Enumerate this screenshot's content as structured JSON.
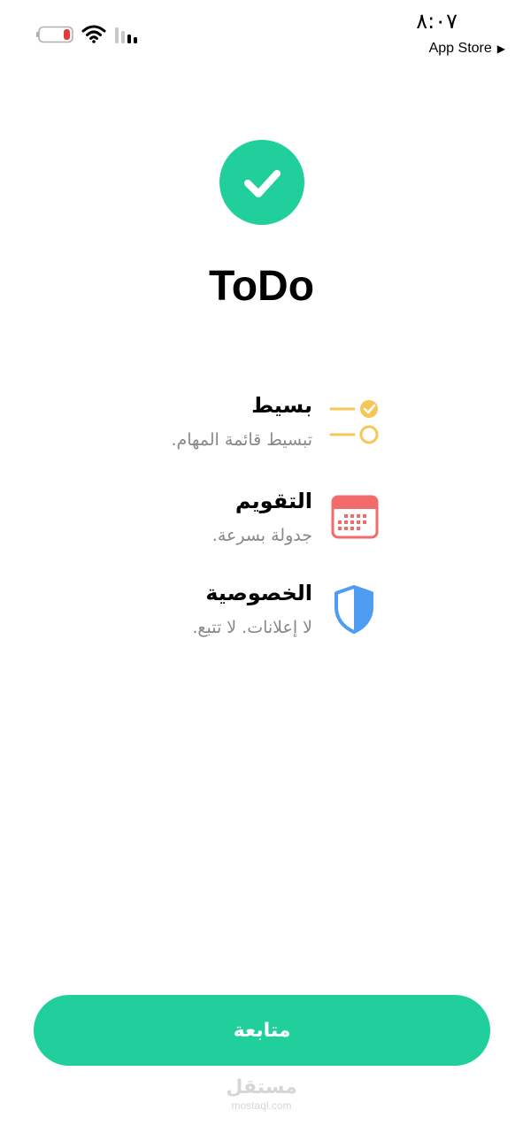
{
  "status_bar": {
    "time": "٨:٠٧",
    "back_app": "App Store",
    "back_arrow": "▶",
    "battery_level": 0.15
  },
  "app": {
    "name": "ToDo",
    "logo_icon": "checkmark-icon"
  },
  "features": [
    {
      "title": "بسيط",
      "description": "تبسيط قائمة المهام.",
      "icon": "checklist-icon"
    },
    {
      "title": "التقويم",
      "description": "جدولة بسرعة.",
      "icon": "calendar-icon"
    },
    {
      "title": "الخصوصية",
      "description": "لا إعلانات. لا تتبع.",
      "icon": "shield-icon"
    }
  ],
  "continue_button": {
    "label": "متابعة"
  },
  "watermark": {
    "arabic": "مستقل",
    "latin": "mostaql.com"
  },
  "colors": {
    "accent": "#21cf9d",
    "checklist": "#f6c656",
    "calendar": "#f26b6b",
    "shield": "#4f9cf3",
    "description_text": "#888888"
  }
}
